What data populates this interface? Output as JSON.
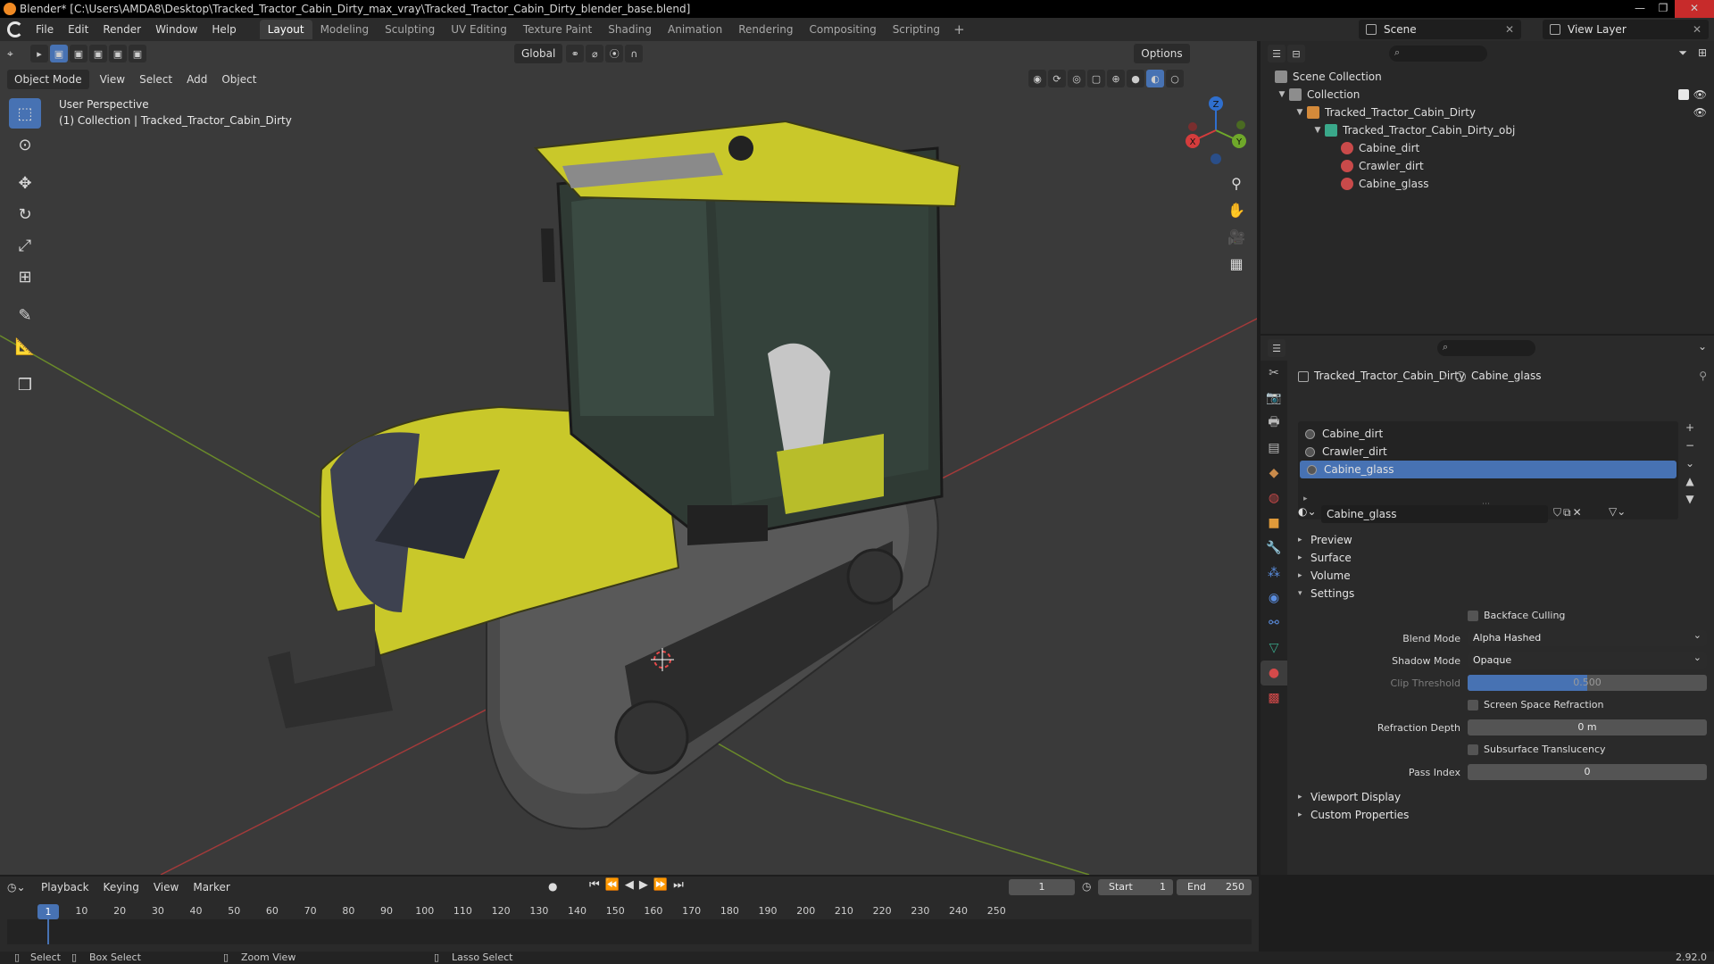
{
  "window": {
    "title": "Blender* [C:\\Users\\AMDA8\\Desktop\\Tracked_Tractor_Cabin_Dirty_max_vray\\Tracked_Tractor_Cabin_Dirty_blender_base.blend]",
    "controls": [
      "—",
      "❐",
      "✕"
    ]
  },
  "menu": [
    "File",
    "Edit",
    "Render",
    "Window",
    "Help"
  ],
  "workspaces": [
    "Layout",
    "Modeling",
    "Sculpting",
    "UV Editing",
    "Texture Paint",
    "Shading",
    "Animation",
    "Rendering",
    "Compositing",
    "Scripting"
  ],
  "active_workspace": "Layout",
  "scene": "Scene",
  "view_layer": "View Layer",
  "viewport": {
    "mode": "Object Mode",
    "menus": [
      "View",
      "Select",
      "Add",
      "Object"
    ],
    "orientation": "Global",
    "options_label": "Options",
    "info_line1": "User Perspective",
    "info_line2": "(1) Collection | Tracked_Tractor_Cabin_Dirty",
    "gizmo": {
      "x": "X",
      "y": "Y",
      "z": "Z"
    }
  },
  "outliner": {
    "items": [
      {
        "label": "Scene Collection",
        "icon": "scene-collection-icon"
      },
      {
        "label": "Collection",
        "icon": "collection-icon"
      },
      {
        "label": "Tracked_Tractor_Cabin_Dirty",
        "icon": "object-icon"
      },
      {
        "label": "Tracked_Tractor_Cabin_Dirty_obj",
        "icon": "mesh-icon"
      },
      {
        "label": "Cabine_dirt",
        "icon": "material-icon"
      },
      {
        "label": "Crawler_dirt",
        "icon": "material-icon"
      },
      {
        "label": "Cabine_glass",
        "icon": "material-icon"
      }
    ]
  },
  "properties": {
    "breadcrumb_object": "Tracked_Tractor_Cabin_Dirty",
    "breadcrumb_material": "Cabine_glass",
    "slots": [
      "Cabine_dirt",
      "Crawler_dirt",
      "Cabine_glass"
    ],
    "selected_slot": 2,
    "material_name": "Cabine_glass",
    "panels": {
      "preview": "Preview",
      "surface": "Surface",
      "volume": "Volume",
      "settings": "Settings",
      "viewport_display": "Viewport Display",
      "custom_properties": "Custom Properties"
    },
    "settings": {
      "backface_culling": "Backface Culling",
      "blend_mode_label": "Blend Mode",
      "blend_mode": "Alpha Hashed",
      "shadow_mode_label": "Shadow Mode",
      "shadow_mode": "Opaque",
      "clip_threshold_label": "Clip Threshold",
      "clip_threshold": "0.500",
      "clip_threshold_fraction": 0.5,
      "ssr_label": "Screen Space Refraction",
      "refraction_depth_label": "Refraction Depth",
      "refraction_depth": "0 m",
      "sss_label": "Subsurface Translucency",
      "pass_index_label": "Pass Index",
      "pass_index": "0"
    }
  },
  "timeline": {
    "menus": [
      "Playback",
      "Keying",
      "View",
      "Marker"
    ],
    "current_frame": "1",
    "start_label": "Start",
    "start": "1",
    "end_label": "End",
    "end": "250",
    "ticks": [
      "10",
      "20",
      "30",
      "40",
      "50",
      "60",
      "70",
      "80",
      "90",
      "100",
      "110",
      "120",
      "130",
      "140",
      "150",
      "160",
      "170",
      "180",
      "190",
      "200",
      "210",
      "220",
      "230",
      "240",
      "250"
    ],
    "playhead": "1"
  },
  "statusbar": {
    "select": "Select",
    "box_select": "Box Select",
    "zoom_view": "Zoom View",
    "lasso_select": "Lasso Select",
    "version": "2.92.0"
  },
  "colors": {
    "accent": "#4772b3",
    "tractor_body": "#c9c82a",
    "grid_x": "#a33a3a",
    "grid_y": "#6a8a2a"
  }
}
